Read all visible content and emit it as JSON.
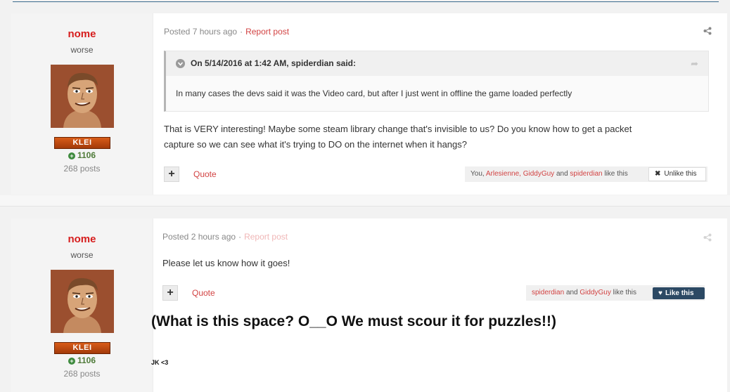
{
  "posts": [
    {
      "author": {
        "name": "nome",
        "title": "worse",
        "badge": "KLEI",
        "reputation": "1106",
        "post_count": "268 posts"
      },
      "meta": {
        "posted": "Posted 7 hours ago",
        "separator": "·",
        "report": "Report post"
      },
      "quote": {
        "cite": "On 5/14/2016 at 1:42 AM, spiderdian said:",
        "body": "In many cases the devs said it was the Video card, but after I just went in offline the game loaded perfectly"
      },
      "content_lines": [
        "That is VERY interesting! Maybe some steam library change that's invisible to us? Do you know how to get a packet",
        "capture so we can see what it's trying to DO on the internet when it hangs?"
      ],
      "actions": {
        "plus": "+",
        "quote": "Quote"
      },
      "likes": {
        "you": "You,",
        "user1": "Arlesienne,",
        "user2": "GiddyGuy",
        "and": "and",
        "user3": "spiderdian",
        "suffix": "like this",
        "button": "Unlike this"
      }
    },
    {
      "author": {
        "name": "nome",
        "title": "worse",
        "badge": "KLEI",
        "reputation": "1106",
        "post_count": "268 posts"
      },
      "meta": {
        "posted": "Posted 2 hours ago",
        "separator": "·",
        "report": "Report post"
      },
      "content_lines": [
        "Please let us know how it goes!"
      ],
      "actions": {
        "plus": "+",
        "quote": "Quote"
      },
      "likes": {
        "user1": "spiderdian",
        "and": "and",
        "user2": "GiddyGuy",
        "suffix": "like this",
        "button": "Like this"
      }
    }
  ],
  "annotation": {
    "main": "(What is this space? O__O We must scour it for puzzles!!)",
    "small": "JK <3"
  },
  "colors": {
    "accent": "#d24343",
    "name": "#d61d1d",
    "like_button": "#2c4964",
    "reputation": "#4e7a38"
  },
  "icons": [
    "share-icon",
    "chevron-down-icon",
    "reply-icon",
    "plus-icon",
    "close-icon",
    "heart-icon",
    "reputation-plus-icon"
  ]
}
